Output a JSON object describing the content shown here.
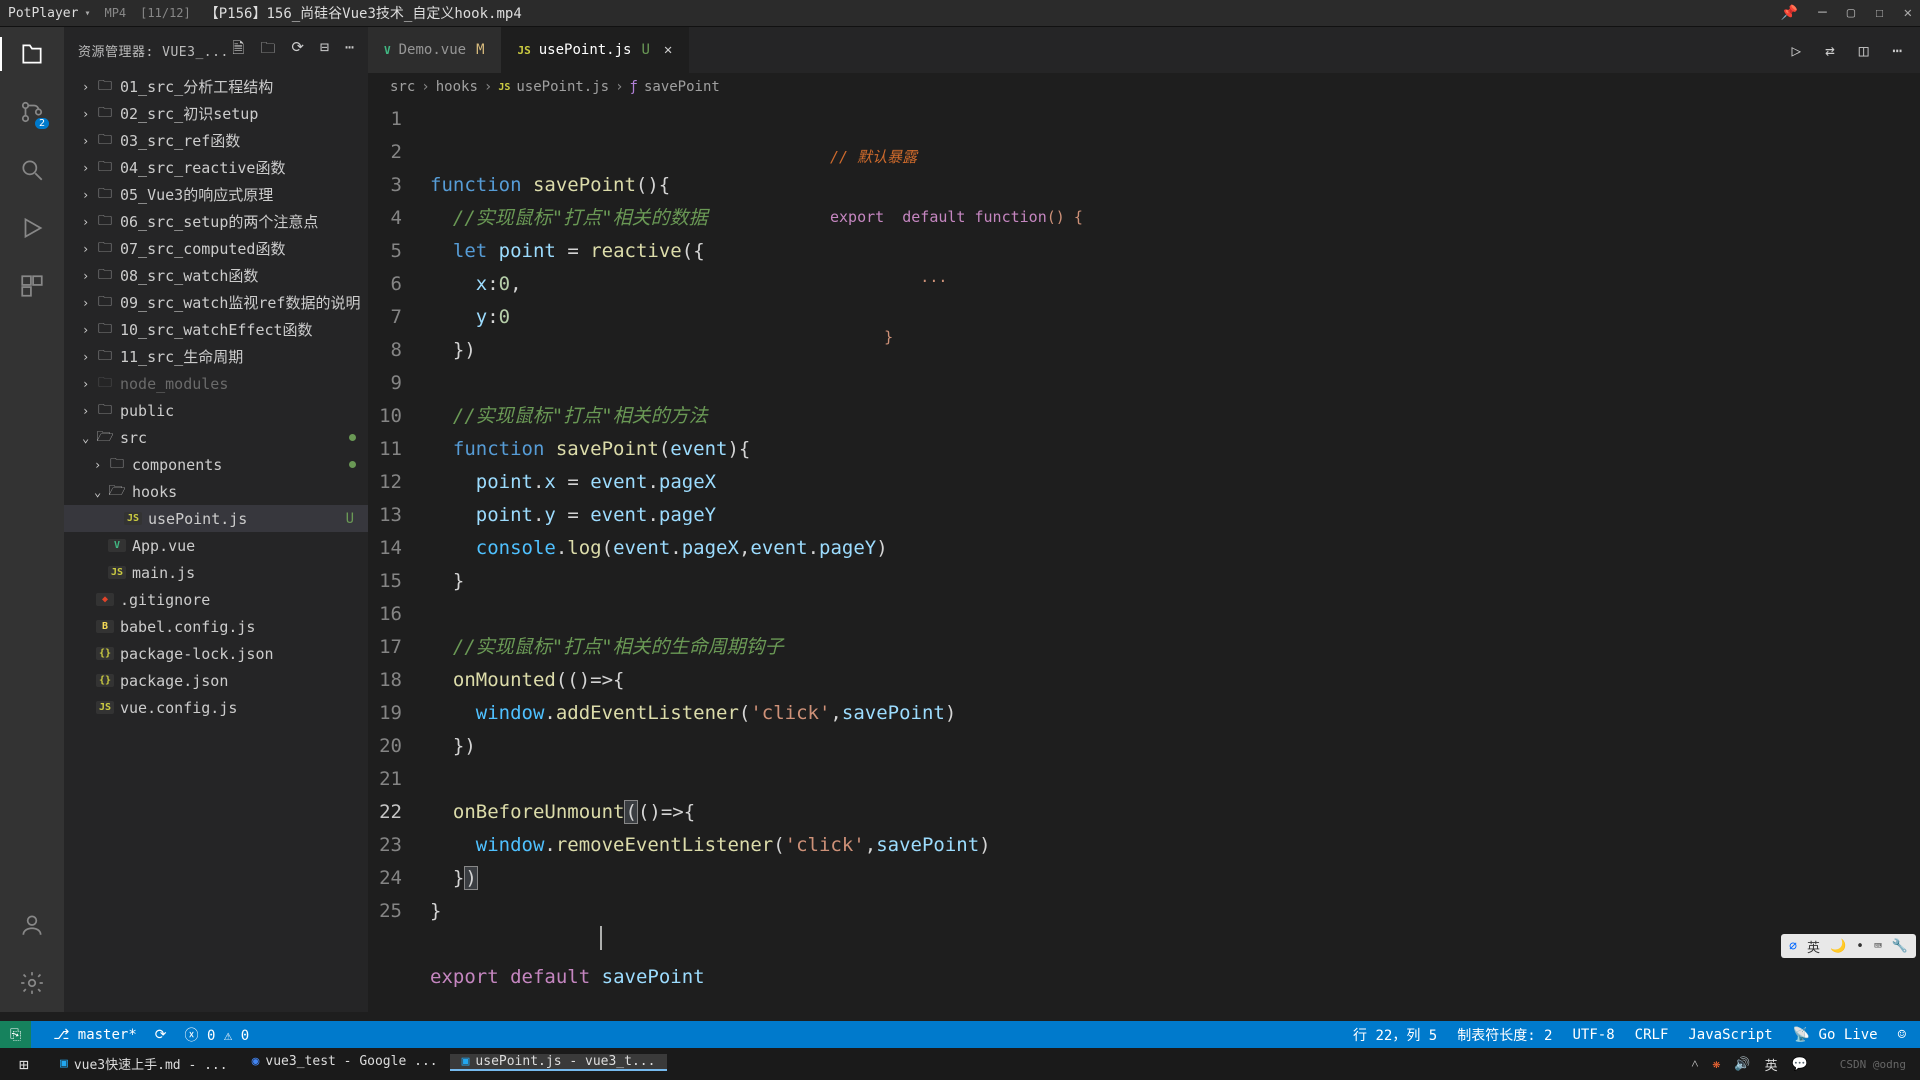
{
  "titlebar": {
    "app": "PotPlayer",
    "format": "MP4",
    "playlist": "[11/12]",
    "video": "【P156】156_尚硅谷Vue3技术_自定义hook.mp4"
  },
  "activity_badge": "2",
  "sidebar": {
    "title": "资源管理器: VUE3_...",
    "actions": [
      "new-file",
      "new-folder",
      "refresh",
      "collapse",
      "more"
    ]
  },
  "tree": [
    {
      "depth": 1,
      "arr": "›",
      "ic": "folder",
      "label": "01_src_分析工程结构"
    },
    {
      "depth": 1,
      "arr": "›",
      "ic": "folder",
      "label": "02_src_初识setup"
    },
    {
      "depth": 1,
      "arr": "›",
      "ic": "folder",
      "label": "03_src_ref函数"
    },
    {
      "depth": 1,
      "arr": "›",
      "ic": "folder",
      "label": "04_src_reactive函数"
    },
    {
      "depth": 1,
      "arr": "›",
      "ic": "folder",
      "label": "05_Vue3的响应式原理"
    },
    {
      "depth": 1,
      "arr": "›",
      "ic": "folder",
      "label": "06_src_setup的两个注意点"
    },
    {
      "depth": 1,
      "arr": "›",
      "ic": "folder",
      "label": "07_src_computed函数"
    },
    {
      "depth": 1,
      "arr": "›",
      "ic": "folder",
      "label": "08_src_watch函数"
    },
    {
      "depth": 1,
      "arr": "›",
      "ic": "folder",
      "label": "09_src_watch监视ref数据的说明"
    },
    {
      "depth": 1,
      "arr": "›",
      "ic": "folder",
      "label": "10_src_watchEffect函数"
    },
    {
      "depth": 1,
      "arr": "›",
      "ic": "folder",
      "label": "11_src_生命周期"
    },
    {
      "depth": 1,
      "arr": "›",
      "ic": "folder",
      "label": "node_modules",
      "dim": true
    },
    {
      "depth": 1,
      "arr": "›",
      "ic": "folder",
      "label": "public"
    },
    {
      "depth": 1,
      "arr": "⌄",
      "ic": "folder-open",
      "label": "src",
      "dot": true
    },
    {
      "depth": 2,
      "arr": "›",
      "ic": "folder",
      "label": "components",
      "dot": true
    },
    {
      "depth": 2,
      "arr": "⌄",
      "ic": "folder-open",
      "label": "hooks"
    },
    {
      "depth": 3,
      "arr": "",
      "ic": "js",
      "label": "usePoint.js",
      "sel": true,
      "mark": "U"
    },
    {
      "depth": 2,
      "arr": "",
      "ic": "vue",
      "label": "App.vue"
    },
    {
      "depth": 2,
      "arr": "",
      "ic": "js",
      "label": "main.js"
    },
    {
      "depth": 1,
      "arr": "",
      "ic": "git",
      "label": ".gitignore"
    },
    {
      "depth": 1,
      "arr": "",
      "ic": "babel",
      "label": "babel.config.js"
    },
    {
      "depth": 1,
      "arr": "",
      "ic": "json",
      "label": "package-lock.json"
    },
    {
      "depth": 1,
      "arr": "",
      "ic": "json",
      "label": "package.json"
    },
    {
      "depth": 1,
      "arr": "",
      "ic": "js",
      "label": "vue.config.js"
    }
  ],
  "tabs": [
    {
      "icon": "vue",
      "label": "Demo.vue",
      "mod": "M",
      "active": false
    },
    {
      "icon": "js",
      "label": "usePoint.js",
      "mod": "U",
      "active": true,
      "close": true
    }
  ],
  "crumbs": [
    "src",
    "hooks",
    "usePoint.js",
    "savePoint"
  ],
  "crumb_icons": [
    "",
    "",
    "js",
    "fn"
  ],
  "gutter_lines": 25,
  "current_line": 22,
  "overlay": {
    "line1": "// 默认暴露",
    "line2_a": "export ",
    "line2_b": " default ",
    "line2_c": "function",
    "line2_d": "() {",
    "line3": "          ...",
    "line4": "      }"
  },
  "code_lines": [
    {
      "html": "<span class='kw'>function</span> <span class='fn'>savePoint</span><span class='pn'>(){</span>"
    },
    {
      "html": "  <span class='cmt'>//实现鼠标\"打点\"相关的数据</span>"
    },
    {
      "html": "  <span class='kw'>let</span> <span class='var'>point</span> <span class='pn'>=</span> <span class='fn'>reactive</span><span class='pn'>({</span>"
    },
    {
      "html": "    <span class='prop'>x</span><span class='pn'>:</span><span class='num'>0</span><span class='pn'>,</span>"
    },
    {
      "html": "    <span class='prop'>y</span><span class='pn'>:</span><span class='num'>0</span>"
    },
    {
      "html": "  <span class='pn'>})</span>"
    },
    {
      "html": ""
    },
    {
      "html": "  <span class='cmt'>//实现鼠标\"打点\"相关的方法</span>"
    },
    {
      "html": "  <span class='kw'>function</span> <span class='fn'>savePoint</span><span class='pn'>(</span><span class='var'>event</span><span class='pn'>){</span>"
    },
    {
      "html": "    <span class='var'>point</span><span class='pn'>.</span><span class='prop'>x</span> <span class='pn'>=</span> <span class='var'>event</span><span class='pn'>.</span><span class='prop'>pageX</span>"
    },
    {
      "html": "    <span class='var'>point</span><span class='pn'>.</span><span class='prop'>y</span> <span class='pn'>=</span> <span class='var'>event</span><span class='pn'>.</span><span class='prop'>pageY</span>"
    },
    {
      "html": "    <span class='obj'>console</span><span class='pn'>.</span><span class='meth'>log</span><span class='pn'>(</span><span class='var'>event</span><span class='pn'>.</span><span class='prop'>pageX</span><span class='pn'>,</span><span class='var'>event</span><span class='pn'>.</span><span class='prop'>pageY</span><span class='pn'>)</span>"
    },
    {
      "html": "  <span class='pn'>}</span>"
    },
    {
      "html": ""
    },
    {
      "html": "  <span class='cmt'>//实现鼠标\"打点\"相关的生命周期钩子</span>"
    },
    {
      "html": "  <span class='fn'>onMounted</span><span class='pn'>(()=&gt;{</span>"
    },
    {
      "html": "    <span class='obj'>window</span><span class='pn'>.</span><span class='meth'>addEventListener</span><span class='pn'>(</span><span class='str'>'click'</span><span class='pn'>,</span><span class='var'>savePoint</span><span class='pn'>)</span>"
    },
    {
      "html": "  <span class='pn'>})</span>"
    },
    {
      "html": ""
    },
    {
      "html": "  <span class='fn'>onBeforeUnmount</span><span class='pn brhl'>(</span><span class='pn'>()=&gt;{</span>"
    },
    {
      "html": "    <span class='obj'>window</span><span class='pn'>.</span><span class='meth'>removeEventListener</span><span class='pn'>(</span><span class='str'>'click'</span><span class='pn'>,</span><span class='var'>savePoint</span><span class='pn'>)</span>"
    },
    {
      "html": "  <span class='pn'>}</span><span class='pn brhl'>)</span>"
    },
    {
      "html": "<span class='pn'>}</span>"
    },
    {
      "html": ""
    },
    {
      "html": "<span class='kw2'>export</span> <span class='kw2'>default</span> <span class='var'>savePoint</span>"
    }
  ],
  "ime": {
    "mode": "英"
  },
  "status": {
    "branch": "master*",
    "sync": "⟳",
    "errors": "0",
    "warnings": "0",
    "lncol": "行 22，列 5",
    "tabsize": "制表符长度: 2",
    "encoding": "UTF-8",
    "eol": "CRLF",
    "lang": "JavaScript",
    "golive": "Go Live"
  },
  "taskbar": {
    "items": [
      {
        "icon": "vscode",
        "label": "vue3快速上手.md - ...",
        "active": false
      },
      {
        "icon": "chrome",
        "label": "vue3_test - Google ...",
        "active": false
      },
      {
        "icon": "vscode",
        "label": "usePoint.js - vue3_t...",
        "active": true
      }
    ],
    "tray_lang": "英",
    "csdn": "CSDN @odng"
  }
}
